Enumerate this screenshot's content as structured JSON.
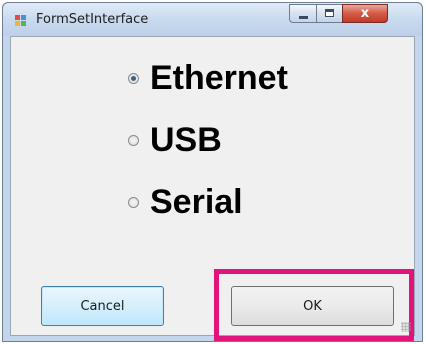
{
  "window": {
    "title": "FormSetInterface",
    "close_glyph": "x",
    "icon": "app-form-icon",
    "accent": "#e0147a"
  },
  "options": [
    {
      "label": "Ethernet",
      "selected": true
    },
    {
      "label": "USB",
      "selected": false
    },
    {
      "label": "Serial",
      "selected": false
    }
  ],
  "buttons": {
    "cancel_label": "Cancel",
    "ok_label": "OK"
  }
}
